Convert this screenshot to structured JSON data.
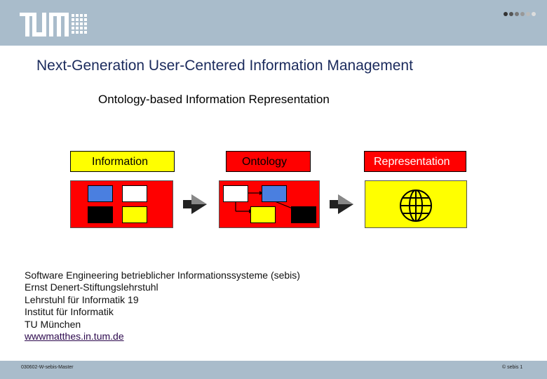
{
  "header": {
    "tum_logo": "TUM",
    "sebis_logo": "sebis"
  },
  "slide": {
    "title": "Next-Generation User-Centered Information Management",
    "subtitle": "Ontology-based Information Representation"
  },
  "diagram": {
    "labels": [
      "Information",
      "Ontology",
      "Representation"
    ],
    "icons": [
      "arrow-right-icon",
      "arrow-right-icon",
      "globe-icon"
    ]
  },
  "footer": {
    "lines": [
      "Software Engineering betrieblicher Informationssysteme (sebis)",
      "Ernst Denert-Stiftungslehrstuhl",
      "Lehrstuhl für Informatik 19",
      "Institut für Informatik",
      "TU München"
    ],
    "link": "wwwmatthes.in.tum.de"
  },
  "bottom": {
    "left": "030602-W-sebis-Master",
    "right": "© sebis   1"
  },
  "colors": {
    "header_bg": "#a9bccb",
    "red": "#ff0000",
    "yellow": "#ffff00",
    "blue": "#4a7fe0",
    "title": "#1a2a5c",
    "sebis_blue": "#2a5a9c"
  }
}
